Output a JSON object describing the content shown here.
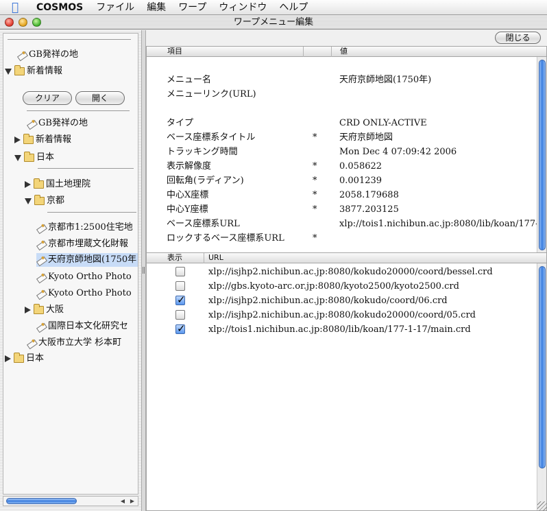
{
  "menubar": {
    "apple_icon": "apple-icon",
    "app_name": "COSMOS",
    "items": [
      "ファイル",
      "編集",
      "ワープ",
      "ウィンドウ",
      "ヘルプ"
    ]
  },
  "window": {
    "title": "ワープメニュー編集"
  },
  "sidebar": {
    "top_items": [
      {
        "label": "GB発祥の地",
        "kind": "item"
      },
      {
        "label": "新着情報",
        "kind": "folder",
        "expanded": true
      }
    ],
    "buttons": {
      "clear": "クリア",
      "open": "開く"
    },
    "tree": [
      {
        "label": "GB発祥の地",
        "kind": "item"
      },
      {
        "label": "新着情報",
        "kind": "folder",
        "expanded": false
      },
      {
        "label": "日本",
        "kind": "folder",
        "expanded": true
      },
      {
        "label": "国土地理院",
        "kind": "folder",
        "expanded": false
      },
      {
        "label": "京都",
        "kind": "folder",
        "expanded": true
      },
      {
        "label": "京都市1:2500住宅地",
        "kind": "item"
      },
      {
        "label": "京都市埋蔵文化財報",
        "kind": "item"
      },
      {
        "label": "天府京師地図(1750年",
        "kind": "item",
        "selected": true
      },
      {
        "label": "Kyoto Ortho Photo",
        "kind": "item"
      },
      {
        "label": "Kyoto Ortho Photo",
        "kind": "item"
      },
      {
        "label": "大阪",
        "kind": "folder",
        "expanded": false
      },
      {
        "label": "国際日本文化研究セ",
        "kind": "item"
      },
      {
        "label": "大阪市立大学 杉本町",
        "kind": "item"
      },
      {
        "label": "日本",
        "kind": "folder",
        "expanded": false
      }
    ]
  },
  "editor": {
    "close_label": "閉じる",
    "properties_header": {
      "name": "項目",
      "value": "値"
    },
    "properties": [
      {
        "name": "メニュー名",
        "required": "",
        "value": "天府京師地図(1750年)"
      },
      {
        "name": "メニューリンク(URL)",
        "required": "",
        "value": ""
      },
      {
        "name": "タイプ",
        "required": "",
        "value": "CRD ONLY-ACTIVE"
      },
      {
        "name": "ベース座標系タイトル",
        "required": "*",
        "value": "天府京師地図"
      },
      {
        "name": "トラッキング時間",
        "required": "",
        "value": "Mon Dec  4 07:09:42 2006"
      },
      {
        "name": "表示解像度",
        "required": "*",
        "value": "0.058622"
      },
      {
        "name": "回転角(ラディアン)",
        "required": "*",
        "value": "0.001239"
      },
      {
        "name": "中心X座標",
        "required": "*",
        "value": "2058.179688"
      },
      {
        "name": "中心Y座標",
        "required": "*",
        "value": "3877.203125"
      },
      {
        "name": "ベース座標系URL",
        "required": "",
        "value": "xlp://tois1.nichibun.ac.jp:8080/lib/koan/177-"
      },
      {
        "name": "ロックするベース座標系URL",
        "required": "*",
        "value": ""
      }
    ],
    "urls_header": {
      "show": "表示",
      "url": "URL"
    },
    "urls": [
      {
        "checked": false,
        "url": "xlp://isjhp2.nichibun.ac.jp:8080/kokudo20000/coord/bessel.crd"
      },
      {
        "checked": false,
        "url": "xlp://gbs.kyoto-arc.or.jp:8080/kyoto2500/kyoto2500.crd"
      },
      {
        "checked": true,
        "url": "xlp://isjhp2.nichibun.ac.jp:8080/kokudo/coord/06.crd"
      },
      {
        "checked": false,
        "url": "xlp://isjhp2.nichibun.ac.jp:8080/kokudo20000/coord/05.crd"
      },
      {
        "checked": true,
        "url": "xlp://tois1.nichibun.ac.jp:8080/lib/koan/177-1-17/main.crd"
      }
    ]
  },
  "colors": {
    "selection": "#c8dcf7",
    "aqua_blue": "#3c7fe0"
  }
}
